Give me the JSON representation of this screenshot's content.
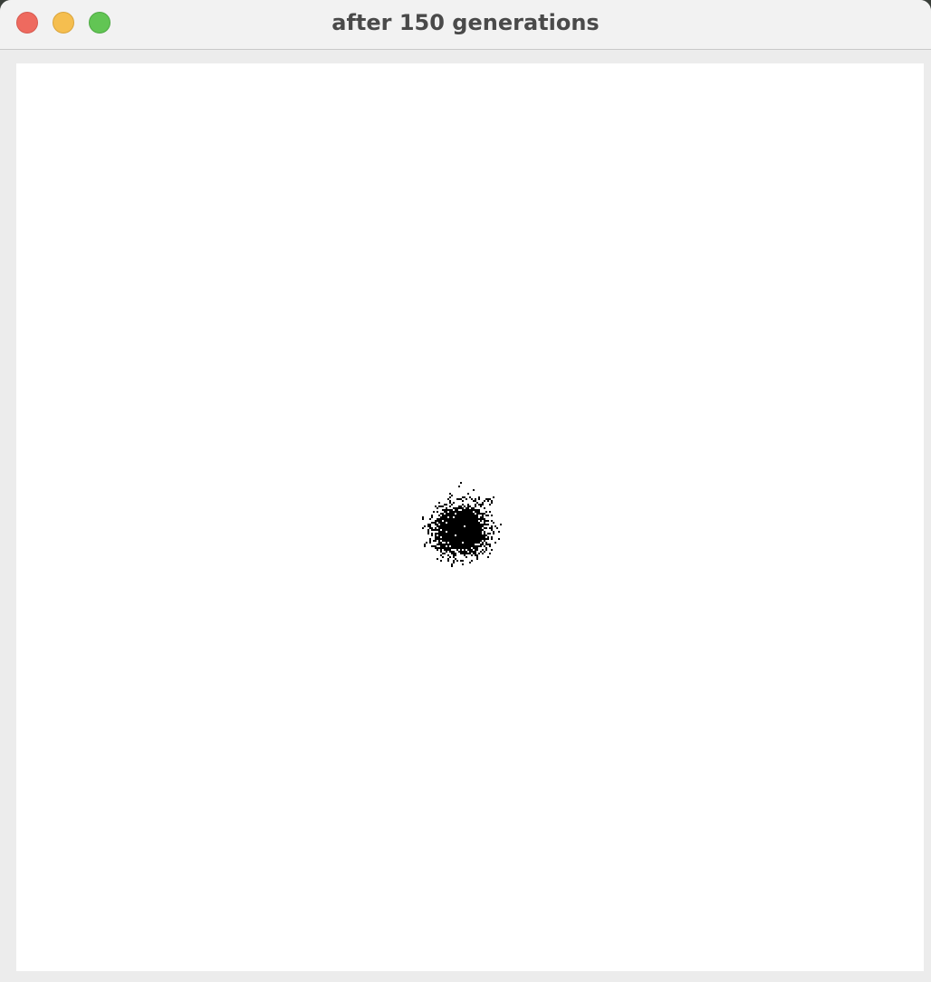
{
  "window": {
    "title": "after 150 generations",
    "controls": {
      "close": "close-icon",
      "minimize": "minimize-icon",
      "zoom": "zoom-icon"
    }
  },
  "simulation": {
    "generations": 150,
    "background_color": "#ffffff",
    "cell_color": "#000000"
  },
  "colors": {
    "close": "#ee6a5f",
    "minimize": "#f5be4f",
    "zoom": "#62c554",
    "title_text": "#4a4a4a"
  }
}
